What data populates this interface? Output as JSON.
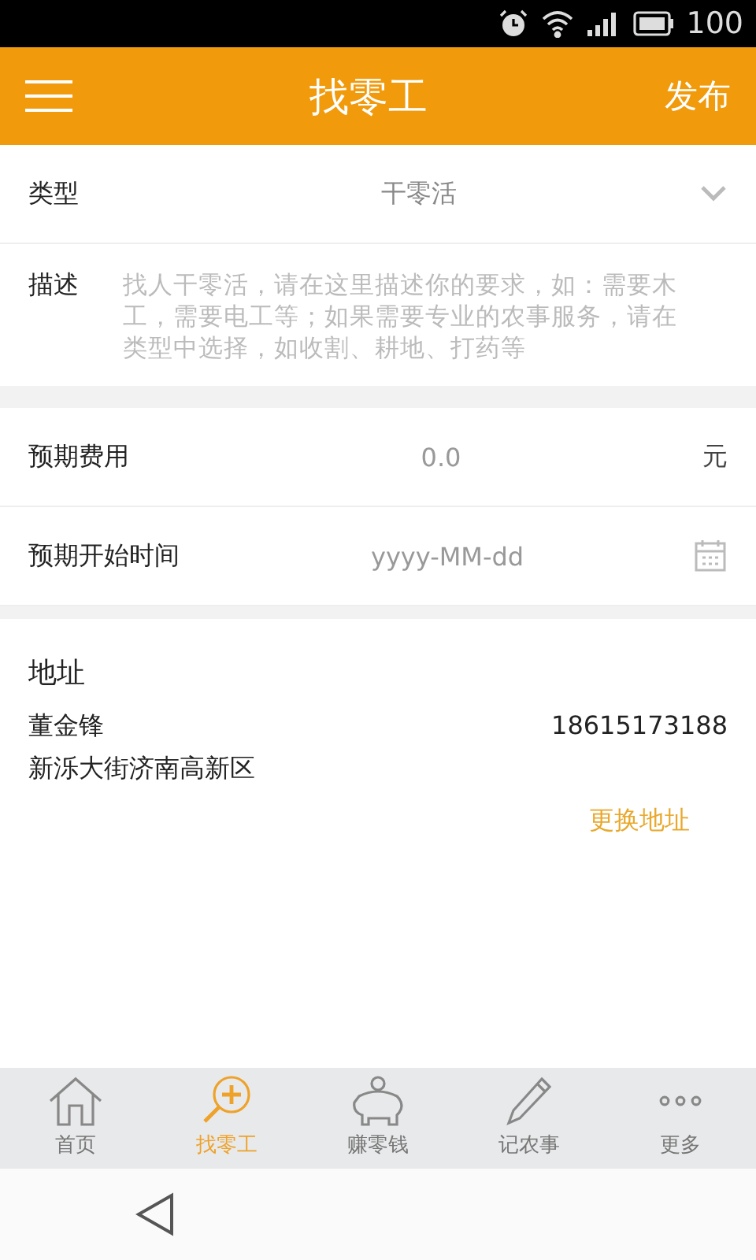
{
  "status_bar": {
    "battery": "100"
  },
  "header": {
    "title": "找零工",
    "action": "发布"
  },
  "form": {
    "type": {
      "label": "类型",
      "value": "干零活"
    },
    "description": {
      "label": "描述",
      "placeholder": "找人干零活，请在这里描述你的要求，如：需要木工，需要电工等；如果需要专业的农事服务，请在类型中选择，如收割、耕地、打药等"
    },
    "fee": {
      "label": "预期费用",
      "placeholder": "0.0",
      "unit": "元"
    },
    "start_date": {
      "label": "预期开始时间",
      "placeholder": "yyyy-MM-dd"
    }
  },
  "address": {
    "title": "地址",
    "name": "董金锋",
    "phone": "18615173188",
    "street": "新泺大街济南高新区",
    "change": "更换地址"
  },
  "tabs": [
    {
      "kind": "home",
      "label": "首页",
      "selected": false
    },
    {
      "kind": "find",
      "label": "找零工",
      "selected": true
    },
    {
      "kind": "earn",
      "label": "赚零钱",
      "selected": false
    },
    {
      "kind": "note",
      "label": "记农事",
      "selected": false
    },
    {
      "kind": "more",
      "label": "更多",
      "selected": false
    }
  ]
}
